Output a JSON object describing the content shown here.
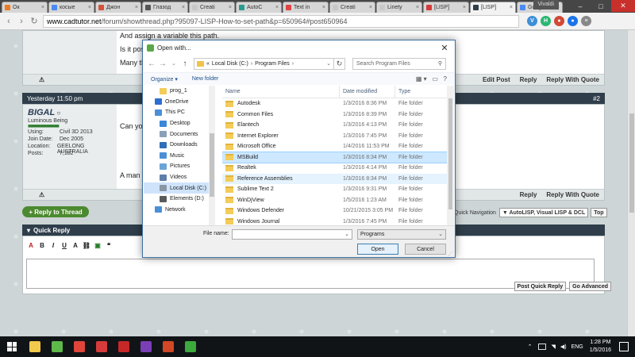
{
  "browser": {
    "tabs": [
      {
        "label": "Ок",
        "color": "#f07a1f",
        "active": false
      },
      {
        "label": "косые",
        "color": "#4a8af4",
        "active": false
      },
      {
        "label": "Джон",
        "color": "#d4533a",
        "active": false
      },
      {
        "label": "Глазод",
        "color": "#555555",
        "active": false
      },
      {
        "label": "Creati",
        "color": "#c9c9c9",
        "active": false
      },
      {
        "label": "AutoC",
        "color": "#2a9d8f",
        "active": false
      },
      {
        "label": "Text in",
        "color": "#e04343",
        "active": false
      },
      {
        "label": "Creati",
        "color": "#c9c9c9",
        "active": false
      },
      {
        "label": "Linety",
        "color": "#c9c9c9",
        "active": false
      },
      {
        "label": "[LISP]",
        "color": "#d63b3b",
        "active": false
      },
      {
        "label": "[LISP]",
        "color": "#2f3e4a",
        "active": true
      },
      {
        "label": "Googl",
        "color": "#4a8af4",
        "active": false
      }
    ],
    "vivaldi_label": "Vivaldi",
    "url_prefix": "www.cadtutor.net",
    "url_rest": "/forum/showthread.php?95097-LISP-How-to-set-path&p=650964#post650964",
    "back_icon": "back-arrow-icon",
    "forward_icon": "forward-arrow-icon",
    "reload_icon": "reload-icon"
  },
  "post1": {
    "lines": [
      "And assign a variable this path.",
      "Is it pos",
      "Many th"
    ],
    "warn": "⚠",
    "actions": [
      "Edit Post",
      "Reply",
      "Reply With Quote"
    ]
  },
  "post2": {
    "timestamp": "Yesterday 11:50 pm",
    "number": "#2",
    "username": "BIGAL",
    "status_dot": "○",
    "user_title": "Luminous Being",
    "stats": [
      {
        "k": "Using:",
        "v": "Civil 3D 2013"
      },
      {
        "k": "Join Date:",
        "v": "Dec 2005"
      },
      {
        "k": "Location:",
        "v": "GEELONG AUSTRALIA"
      },
      {
        "k": "Posts:",
        "v": "7,182"
      }
    ],
    "text": "Can you",
    "text2": "A man w",
    "actions": [
      "Reply",
      "Reply With Quote"
    ]
  },
  "reply_to_thread": "+ Reply to Thread",
  "quick_nav": {
    "label": "Quick Navigation",
    "selected": "▼ AutoLISP, Visual LISP & DCL",
    "top": "Top"
  },
  "quick_reply": {
    "title": "Quick Reply",
    "post_button": "Post Quick Reply",
    "advanced_button": "Go Advanced"
  },
  "dialog": {
    "title": "Open with...",
    "crumbs": [
      "Local Disk (C:)",
      "Program Files"
    ],
    "crumb_prefix": "«",
    "search_placeholder": "Search Program Files",
    "organize": "Organize ▾",
    "new_folder": "New folder",
    "tree": [
      {
        "label": "prog_1",
        "color": "#f3cc5a",
        "sub": true,
        "selected": false
      },
      {
        "label": "OneDrive",
        "color": "#2d6fd0",
        "sub": false,
        "selected": false
      },
      {
        "label": "This PC",
        "color": "#4b8fd6",
        "sub": false,
        "selected": false
      },
      {
        "label": "Desktop",
        "color": "#3a86d8",
        "sub": true,
        "selected": false
      },
      {
        "label": "Documents",
        "color": "#8aa0b8",
        "sub": true,
        "selected": false
      },
      {
        "label": "Downloads",
        "color": "#2f6fb8",
        "sub": true,
        "selected": false
      },
      {
        "label": "Music",
        "color": "#4b8fd6",
        "sub": true,
        "selected": false
      },
      {
        "label": "Pictures",
        "color": "#6aa4d8",
        "sub": true,
        "selected": false
      },
      {
        "label": "Videos",
        "color": "#5d7ea8",
        "sub": true,
        "selected": false
      },
      {
        "label": "Local Disk (C:)",
        "color": "#8a96a4",
        "sub": true,
        "selected": true
      },
      {
        "label": "Elements (D:)",
        "color": "#5a5a5a",
        "sub": true,
        "selected": false
      },
      {
        "label": "Network",
        "color": "#4b8fd6",
        "sub": false,
        "selected": false
      }
    ],
    "columns": [
      "Name",
      "Date modified",
      "Type"
    ],
    "rows": [
      {
        "name": "Autodesk",
        "date": "1/3/2016 8:36 PM",
        "type": "File folder",
        "state": ""
      },
      {
        "name": "Common Files",
        "date": "1/3/2016 8:39 PM",
        "type": "File folder",
        "state": ""
      },
      {
        "name": "Elantech",
        "date": "1/3/2016 4:13 PM",
        "type": "File folder",
        "state": ""
      },
      {
        "name": "Internet Explorer",
        "date": "1/3/2016 7:45 PM",
        "type": "File folder",
        "state": ""
      },
      {
        "name": "Microsoft Office",
        "date": "1/4/2016 11:53 PM",
        "type": "File folder",
        "state": ""
      },
      {
        "name": "MSBuild",
        "date": "1/3/2016 8:34 PM",
        "type": "File folder",
        "state": "hl"
      },
      {
        "name": "Realtek",
        "date": "1/3/2016 4:14 PM",
        "type": "File folder",
        "state": ""
      },
      {
        "name": "Reference Assemblies",
        "date": "1/3/2016 8:34 PM",
        "type": "File folder",
        "state": "hv"
      },
      {
        "name": "Sublime Text 2",
        "date": "1/3/2016 9:31 PM",
        "type": "File folder",
        "state": ""
      },
      {
        "name": "WinDjView",
        "date": "1/5/2016 1:23 AM",
        "type": "File folder",
        "state": ""
      },
      {
        "name": "Windows Defender",
        "date": "10/21/2015 3:05 PM",
        "type": "File folder",
        "state": ""
      },
      {
        "name": "Windows Journal",
        "date": "1/3/2016 7:45 PM",
        "type": "File folder",
        "state": ""
      }
    ],
    "file_name_label": "File name:",
    "file_name_value": "",
    "file_type": "Programs",
    "open_button": "Open",
    "cancel_button": "Cancel"
  },
  "taskbar": {
    "apps": [
      {
        "name": "file-explorer-icon",
        "color": "#f2c94c"
      },
      {
        "name": "torrent-icon",
        "color": "#5fb84a"
      },
      {
        "name": "chrome-icon",
        "color": "#e0453a"
      },
      {
        "name": "vivaldi-icon",
        "color": "#d63b3b"
      },
      {
        "name": "autocad-icon",
        "color": "#c62828"
      },
      {
        "name": "draw-app-icon",
        "color": "#7b3fb5"
      },
      {
        "name": "presentation-icon",
        "color": "#d24726"
      },
      {
        "name": "clover-icon",
        "color": "#3caa3c"
      }
    ],
    "language": "ENG",
    "time": "1:28 PM",
    "date": "1/5/2016"
  }
}
